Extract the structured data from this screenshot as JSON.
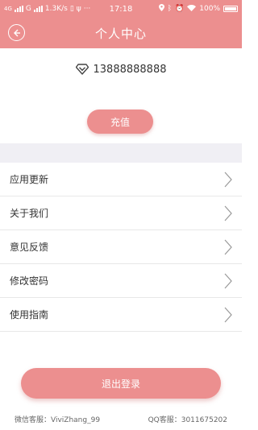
{
  "status_bar": {
    "network_left": "4G",
    "carrier_g": "G",
    "speed": "1.3K/s",
    "more": "···",
    "time": "17:18",
    "battery_text": "100%"
  },
  "header": {
    "title": "个人中心"
  },
  "account": {
    "phone": "13888888888",
    "recharge_label": "充值"
  },
  "menu": {
    "items": [
      {
        "label": "应用更新"
      },
      {
        "label": "关于我们"
      },
      {
        "label": "意见反馈"
      },
      {
        "label": "修改密码"
      },
      {
        "label": "使用指南"
      }
    ]
  },
  "logout_label": "退出登录",
  "footer": {
    "wechat": "微信客服：ViviZhang_99",
    "qq": "QQ客服：3011675202"
  },
  "colors": {
    "accent": "#ec8f8f",
    "separator": "#f0eff4"
  }
}
